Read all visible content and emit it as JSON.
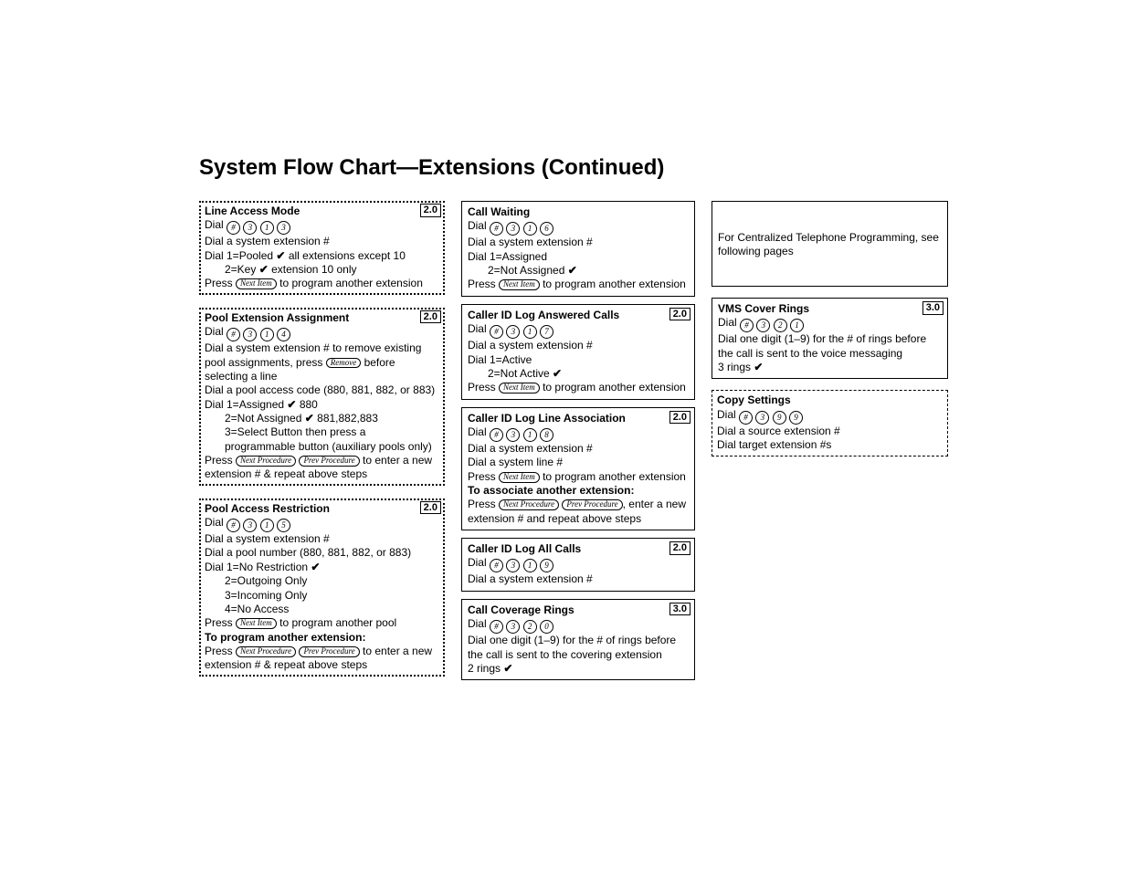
{
  "header": {
    "title": "System Flow Chart—Extensions (Continued)"
  },
  "g": {
    "hash": "#",
    "d0": "0",
    "d1": "1",
    "d2": "2",
    "d3": "3",
    "d4": "4",
    "d5": "5",
    "d6": "6",
    "d7": "7",
    "d8": "8",
    "d9": "9",
    "check": "✔",
    "nextItem": "Next Item",
    "nextProc": "Next Procedure",
    "prevProc": "Prev Procedure",
    "remove": "Remove"
  },
  "w": {
    "dial": "Dial",
    "press": "Press",
    "progExt": "to program another extension"
  },
  "c1": {
    "lineAccess": {
      "title": "Line Access Mode",
      "ver": "2.0",
      "l1": "Dial a system extension #",
      "l2a": "Dial 1=Pooled",
      "l2b": "all extensions except 10",
      "l3a": "2=Key",
      "l3b": "extension 10 only"
    },
    "poolExt": {
      "title": "Pool Extension Assignment",
      "ver": "2.0",
      "l1a": "Dial a system extension # to remove existing pool assignments, press",
      "l1b": "before selecting a line",
      "l2": "Dial a pool access code (880, 881, 882, or 883)",
      "l3a": "Dial 1=Assigned",
      "l3b": "880",
      "l4a": "2=Not Assigned",
      "l4b": "881,882,883",
      "l5": "3=Select Button then press a programmable button (auxiliary pools only)",
      "l6": "to enter a new extension # & repeat above steps"
    },
    "poolAcc": {
      "title": "Pool Access Restriction",
      "ver": "2.0",
      "l1": "Dial a system extension #",
      "l2": "Dial a pool number (880, 881, 882, or 883)",
      "l3": "Dial 1=No Restriction",
      "l4": "2=Outgoing Only",
      "l5": "3=Incoming Only",
      "l6": "4=No Access",
      "l7": "to program another pool",
      "sub": "To program another extension:",
      "l8": "to enter a new extension # & repeat above steps"
    }
  },
  "c2": {
    "callWait": {
      "title": "Call Waiting",
      "l1": "Dial a system extension #",
      "l2": "Dial 1=Assigned",
      "l3": "2=Not Assigned"
    },
    "cidAns": {
      "title": "Caller ID Log Answered Calls",
      "ver": "2.0",
      "l1": "Dial a system extension #",
      "l2": "Dial 1=Active",
      "l3": "2=Not Active"
    },
    "cidLine": {
      "title": "Caller ID Log Line Association",
      "ver": "2.0",
      "l1": "Dial a system extension #",
      "l2": "Dial a system line #",
      "sub": "To associate another extension:",
      "l3": ", enter a new extension # and repeat above steps"
    },
    "cidAll": {
      "title": "Caller ID Log All Calls",
      "ver": "2.0",
      "l1": "Dial a system extension #"
    },
    "callCov": {
      "title": "Call Coverage Rings",
      "ver": "3.0",
      "l1": "Dial one digit (1–9) for the # of rings before the call is sent to the covering extension",
      "l2": "2 rings"
    }
  },
  "c3": {
    "note": {
      "l1": "For Centralized Telephone Programming, see following pages"
    },
    "vms": {
      "title": "VMS Cover Rings",
      "ver": "3.0",
      "l1": "Dial one digit (1–9) for the # of rings before the call is sent to the voice messaging",
      "l2": "3 rings"
    },
    "copy": {
      "title": "Copy Settings",
      "l1": "Dial a source extension #",
      "l2": "Dial target extension #s"
    }
  }
}
